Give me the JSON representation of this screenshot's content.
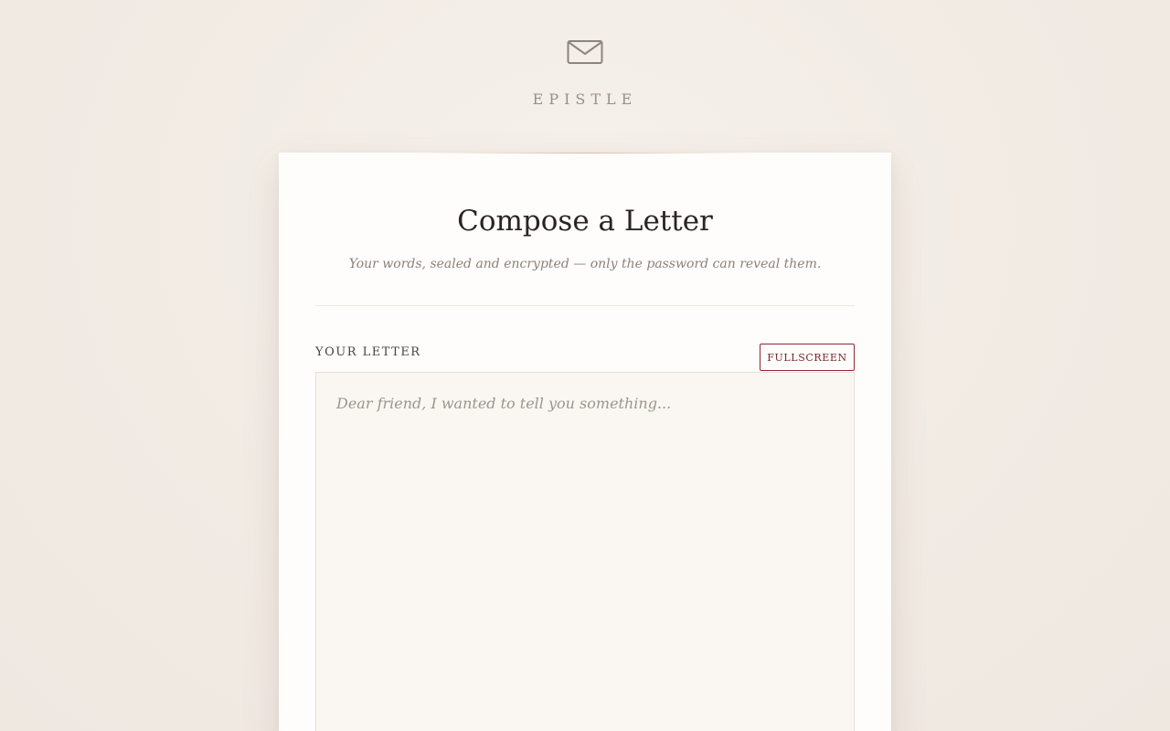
{
  "brand": {
    "icon": "envelope-icon",
    "name": "EPISTLE"
  },
  "card": {
    "title": "Compose a Letter",
    "subtitle": "Your words, sealed and encrypted — only the password can reveal them."
  },
  "letter": {
    "label": "YOUR LETTER",
    "fullscreen_label": "FULLSCREEN",
    "placeholder": "Dear friend, I wanted to tell you something...",
    "value": ""
  },
  "colors": {
    "accent": "#8b2a32",
    "background": "#f1ebe4",
    "card": "#fefdfb",
    "text_dark": "#2c2421",
    "text_muted": "#8b817b"
  }
}
